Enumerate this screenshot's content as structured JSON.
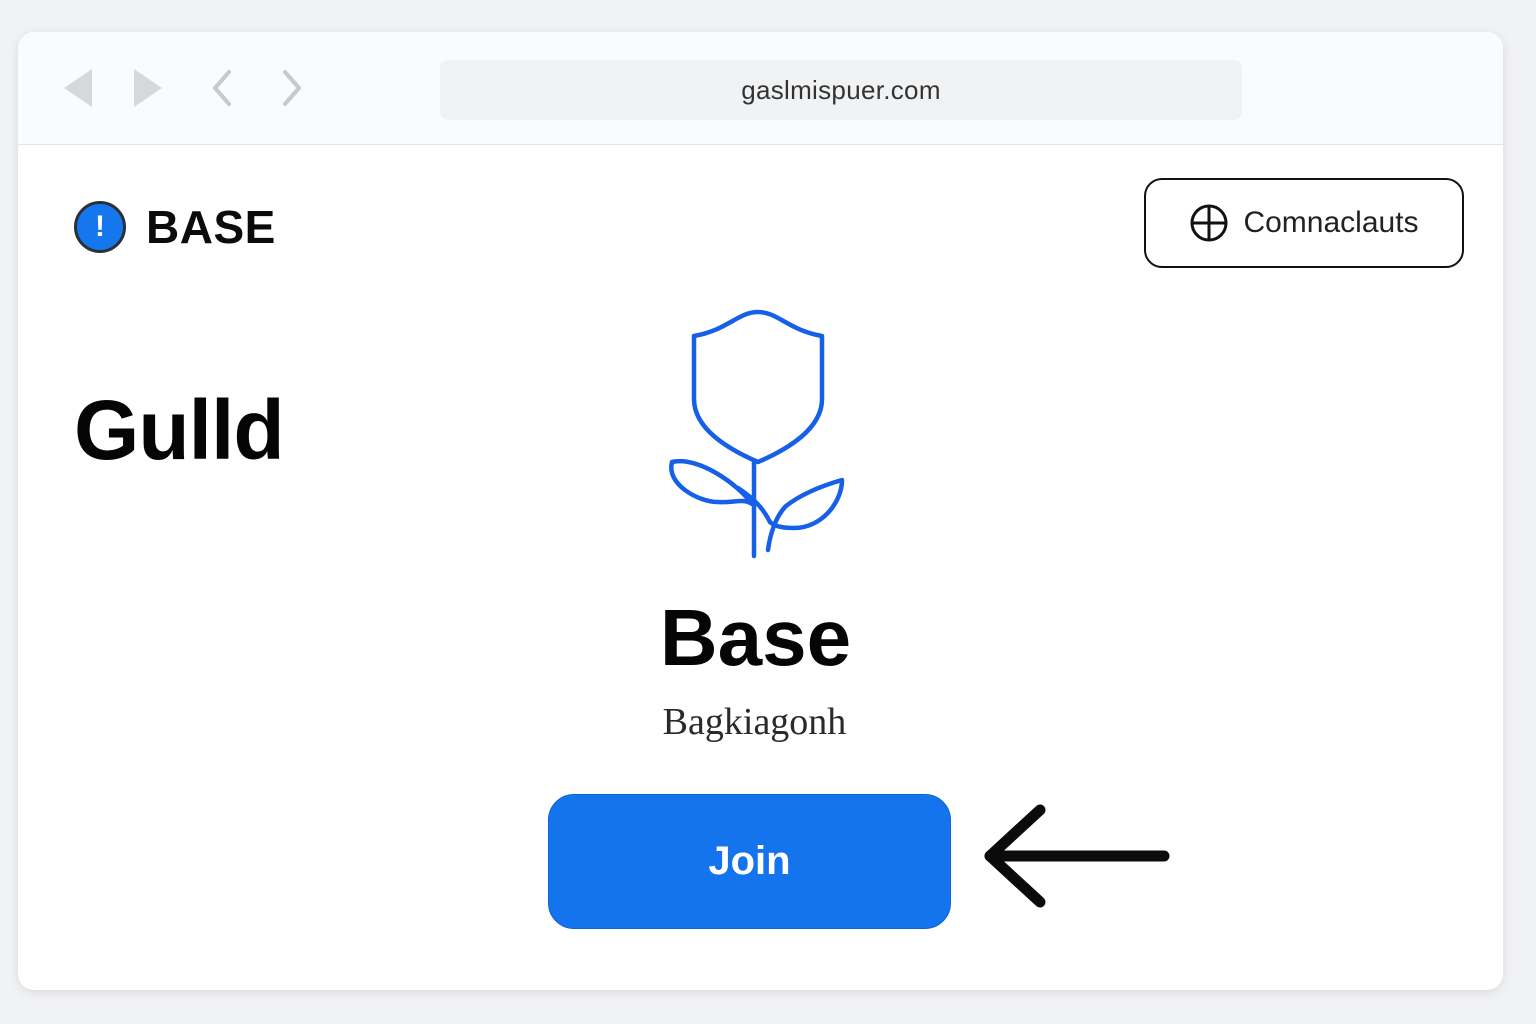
{
  "browser": {
    "url": "gaslmispuer.com"
  },
  "header": {
    "brand_badge": "!",
    "brand_name": "BASE",
    "connect_label": "Comnaclauts"
  },
  "main": {
    "page_title": "Gulld",
    "community_name": "Base",
    "community_subtitle": "Bagkiagonh",
    "join_label": "Join"
  },
  "colors": {
    "accent": "#1474ee",
    "icon_stroke": "#1660e8"
  }
}
